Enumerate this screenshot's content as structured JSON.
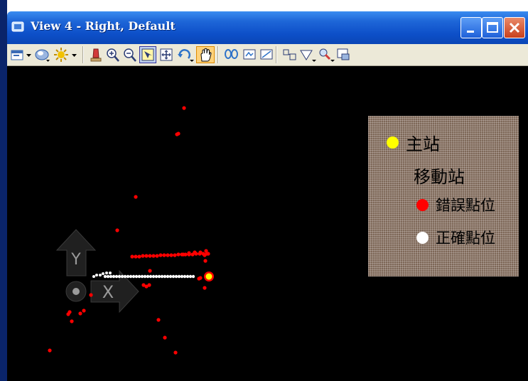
{
  "window": {
    "title": "View 4 - Right, Default",
    "controls": {
      "minimize_icon": "minimize-icon",
      "maximize_icon": "maximize-icon",
      "close_icon": "close-icon"
    }
  },
  "toolbar": {
    "tools": [
      "view-attributes-icon",
      "dropdown-arrow-icon",
      "render-icon",
      "lights-icon",
      "dropdown-arrow-icon",
      "update-view-icon",
      "zoom-in-icon",
      "zoom-out-icon",
      "window-area-icon",
      "fit-view-icon",
      "rotate-view-icon",
      "pan-view-icon",
      "view-previous-icon",
      "copy-view-icon",
      "camera-icon",
      "clip-volume-icon",
      "clip-mask-icon",
      "display-set-icon",
      "view-settings-icon"
    ]
  },
  "axes": {
    "y_label": "Y",
    "x_label": "X"
  },
  "legend": {
    "base_station": {
      "label": "主站",
      "color": "#ffff00"
    },
    "rover": {
      "label": "移動站"
    },
    "error_point": {
      "label": "錯誤點位",
      "color": "#ff0000"
    },
    "correct_point": {
      "label": "正確點位",
      "color": "#ffffff"
    }
  },
  "colors": {
    "viewport_bg": "#000000",
    "error_point": "#ff0000",
    "correct_point": "#ffffff",
    "base_station": "#ffff00"
  }
}
